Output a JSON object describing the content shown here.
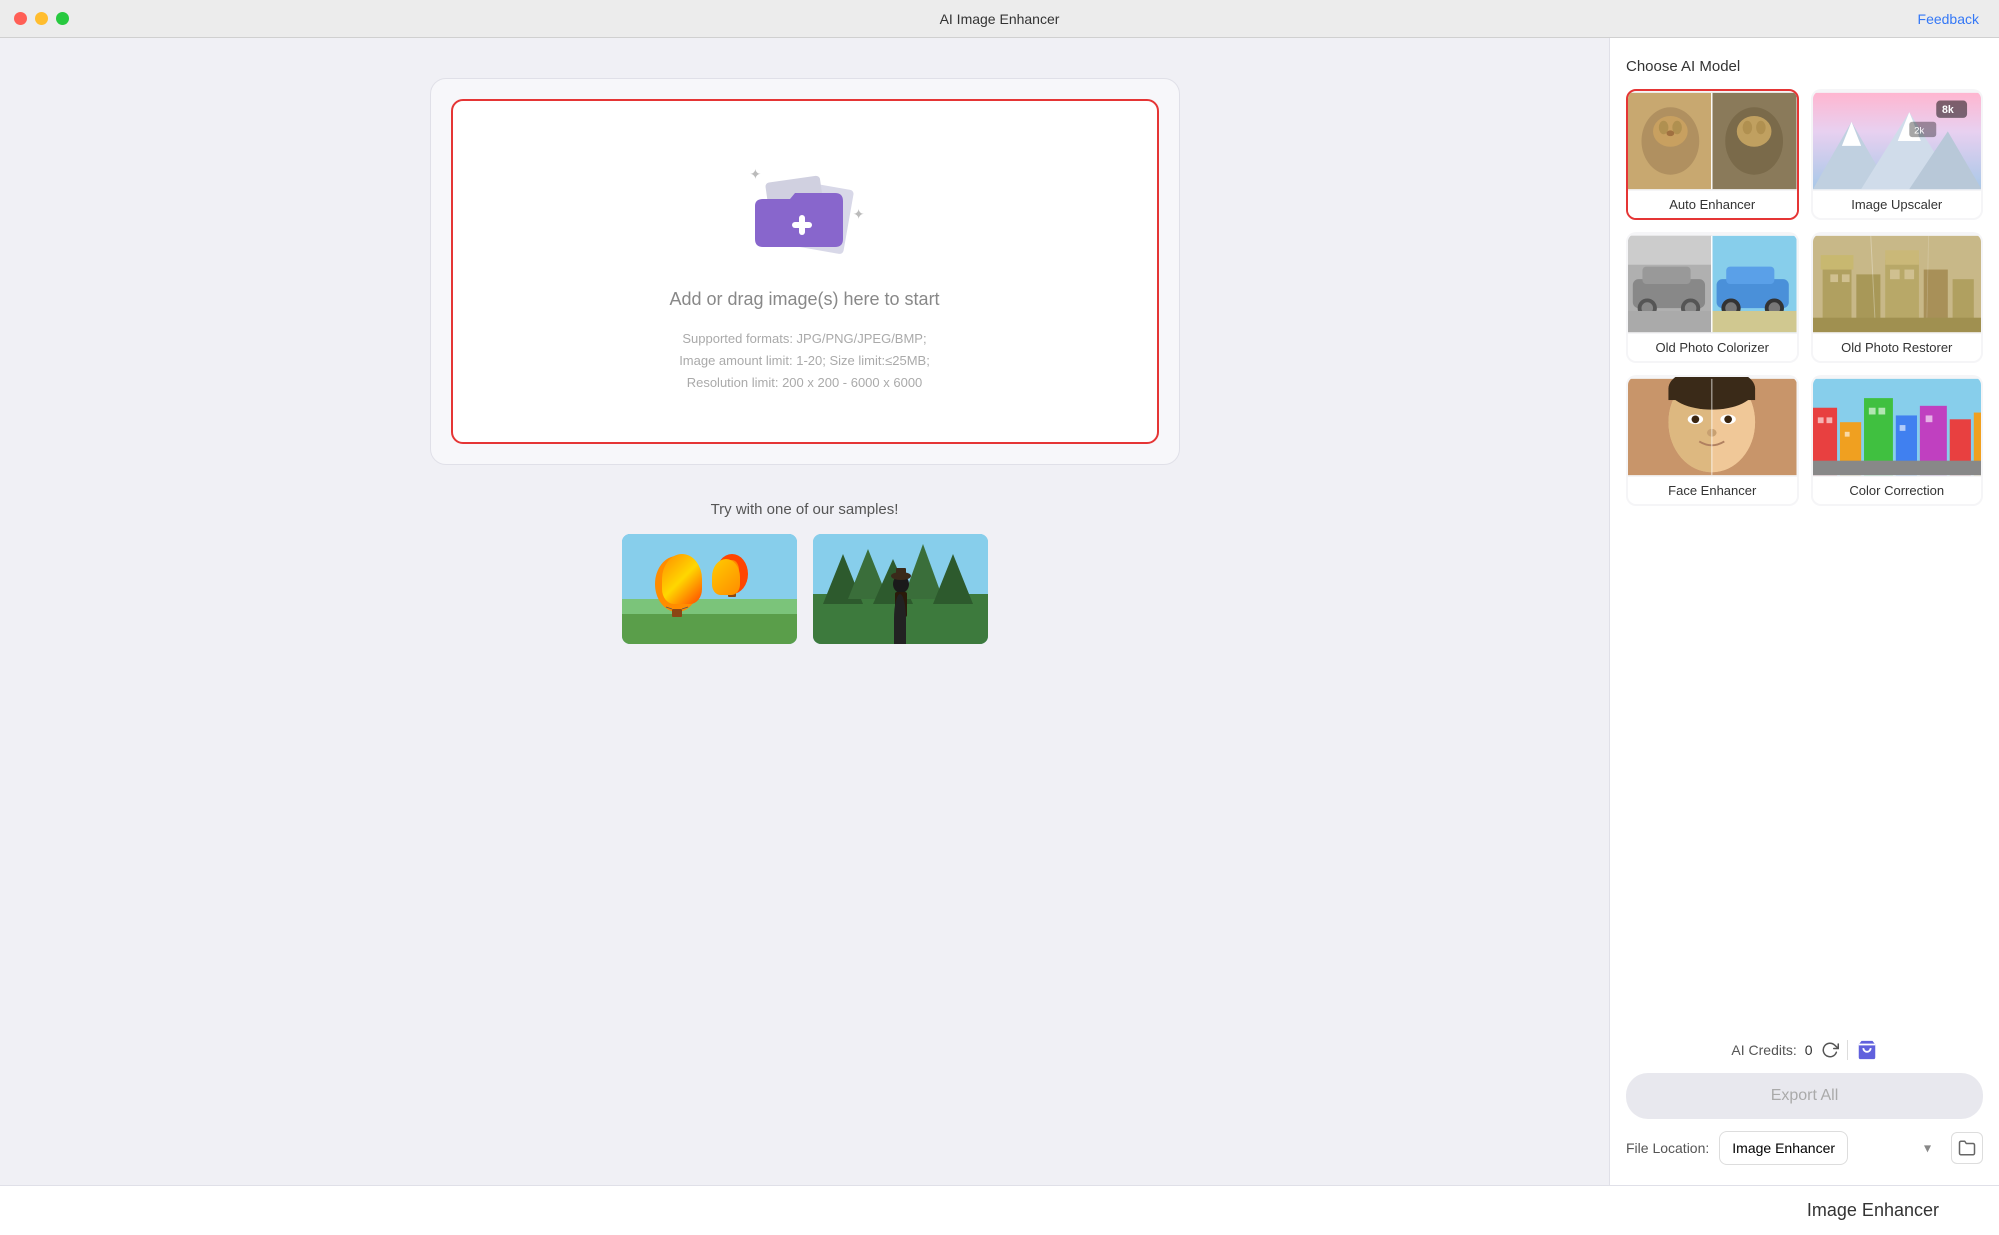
{
  "titlebar": {
    "title": "AI Image Enhancer",
    "feedback_label": "Feedback"
  },
  "upload": {
    "zone_text": "Add or drag image(s) here to start",
    "formats_text": "Supported formats: JPG/PNG/JPEG/BMP;",
    "limit_text": "Image amount limit: 1-20; Size limit:≤25MB;",
    "resolution_text": "Resolution limit: 200 x 200 - 6000 x 6000"
  },
  "samples": {
    "title": "Try with one of our samples!"
  },
  "sidebar": {
    "choose_model_label": "Choose AI Model",
    "models": [
      {
        "id": "auto-enhancer",
        "label": "Auto Enhancer",
        "selected": true
      },
      {
        "id": "image-upscaler",
        "label": "Image Upscaler",
        "selected": false
      },
      {
        "id": "old-photo-colorizer",
        "label": "Old Photo Colorizer",
        "selected": false
      },
      {
        "id": "old-photo-restorer",
        "label": "Old Photo Restorer",
        "selected": false
      },
      {
        "id": "face-enhancer",
        "label": "Face Enhancer",
        "selected": false
      },
      {
        "id": "color-correction",
        "label": "Color Correction",
        "selected": false
      }
    ],
    "credits_label": "AI Credits:",
    "credits_value": "0",
    "export_label": "Export All",
    "file_location_label": "File Location:",
    "file_location_value": "Image Enhancer"
  },
  "bottom_bar": {
    "label": "Image Enhancer"
  }
}
